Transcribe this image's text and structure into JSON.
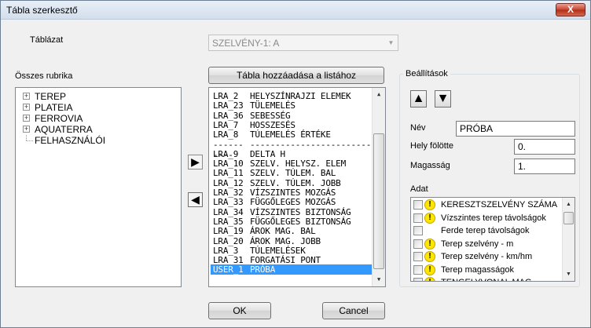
{
  "window": {
    "title": "Tábla szerkesztő",
    "close_label": "X"
  },
  "table_label": "Táblázat",
  "table_select": {
    "value": "SZELVÉNY-1: A"
  },
  "all_columns_label": "Összes rubrika",
  "add_button_label": "Tábla hozzáadása a listához",
  "tree_items": [
    {
      "label": "TEREP",
      "expandable": true
    },
    {
      "label": "PLATEIA",
      "expandable": true
    },
    {
      "label": "FERROVIA",
      "expandable": true
    },
    {
      "label": "AQUATERRA",
      "expandable": true
    },
    {
      "label": "FELHASZNÁLÓI",
      "expandable": false
    }
  ],
  "list_items": [
    {
      "code": "LRA_2",
      "name": "HELYSZÍNRAJZI ELEMEK"
    },
    {
      "code": "LRA_23",
      "name": "TÜLEMELÉS"
    },
    {
      "code": "LRA_36",
      "name": "SEBESSÉG"
    },
    {
      "code": "LRA_7",
      "name": "HOSSZESÉS"
    },
    {
      "code": "LRA_8",
      "name": "TÚLEMELÉS ÉRTÉKE"
    },
    {
      "code": "------",
      "name": "----------------------------"
    },
    {
      "code": "LRA_9",
      "name": "DELTA H"
    },
    {
      "code": "LRA_10",
      "name": "SZELV. HELYSZ. ELEM"
    },
    {
      "code": "LRA_11",
      "name": "SZELV. TÚLEM. BAL"
    },
    {
      "code": "LRA_12",
      "name": "SZELV. TÚLEM. JOBB"
    },
    {
      "code": "LRA_32",
      "name": "VÍZSZINTES MOZGÁS"
    },
    {
      "code": "LRA_33",
      "name": "FÜGGŐLEGES MOZGÁS"
    },
    {
      "code": "LRA_34",
      "name": "VÍZSZINTES BIZTONSÁG"
    },
    {
      "code": "LRA_35",
      "name": "FÜGGŐLEGES BIZTONSÁG"
    },
    {
      "code": "LRA_19",
      "name": "ÁROK MAG. BAL"
    },
    {
      "code": "LRA_20",
      "name": "ÁROK MAG. JOBB"
    },
    {
      "code": "LRA_3",
      "name": "TÚLEMELÉSEK"
    },
    {
      "code": "LRA_31",
      "name": "FORGATÁSI PONT"
    },
    {
      "code": "USER_1",
      "name": "PRÓBA"
    }
  ],
  "list_selected_index": 18,
  "settings": {
    "label": "Beállítások",
    "name_label": "Név",
    "name_value": "PRÓBA",
    "height_above_label": "Hely fölötte",
    "height_above_value": "0.",
    "height_label": "Magasság",
    "height_value": "1.",
    "data_label": "Adat",
    "data_items": [
      {
        "label": "KERESZTSZELVÉNY SZÁMA",
        "warn": true
      },
      {
        "label": "Vízszintes terep távolságok",
        "warn": true
      },
      {
        "label": "Ferde terep távolságok",
        "warn": false
      },
      {
        "label": "Terep szelvény - m",
        "warn": true
      },
      {
        "label": "Terep szelvény - km/hm",
        "warn": true
      },
      {
        "label": "Terep magasságok",
        "warn": true
      },
      {
        "label": "TENGELYVONAL MAG.",
        "warn": true
      }
    ]
  },
  "ok_label": "OK",
  "cancel_label": "Cancel",
  "icons": {
    "move_right": "▶",
    "move_left": "◀",
    "up": "▲",
    "down": "▼",
    "scroll_up": "▲",
    "scroll_down": "▼",
    "combo_arrow": "▼",
    "warn": "!"
  }
}
